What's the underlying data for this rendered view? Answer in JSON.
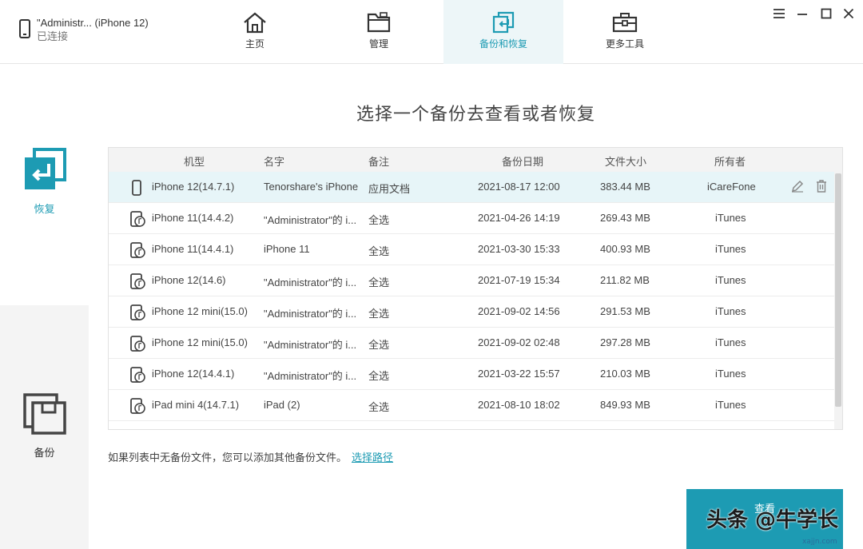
{
  "device": {
    "name": "\"Administr... (iPhone 12)",
    "status": "已连接",
    "icon": "phone-icon"
  },
  "nav": [
    {
      "label": "主页",
      "icon": "home-icon"
    },
    {
      "label": "管理",
      "icon": "folder-icon"
    },
    {
      "label": "备份和恢复",
      "icon": "backup-restore-icon",
      "active": true
    },
    {
      "label": "更多工具",
      "icon": "toolbox-icon"
    }
  ],
  "window_controls": [
    "menu-icon",
    "minimize-icon",
    "maximize-icon",
    "close-icon"
  ],
  "sidebar": {
    "restore_label": "恢复",
    "backup_label": "备份"
  },
  "main": {
    "title": "选择一个备份去查看或者恢复",
    "columns": [
      "机型",
      "名字",
      "备注",
      "备份日期",
      "文件大小",
      "所有者"
    ],
    "rows": [
      {
        "model": "iPhone 12(14.7.1)",
        "name": "Tenorshare's iPhone",
        "note": "应用文档",
        "date": "2021-08-17 12:00",
        "size": "383.44 MB",
        "owner": "iCareFone",
        "selected": true,
        "icon": "phone-icon"
      },
      {
        "model": "iPhone 11(14.4.2)",
        "name": "\"Administrator\"的 i...",
        "note": "全选",
        "date": "2021-04-26 14:19",
        "size": "269.43 MB",
        "owner": "iTunes",
        "icon": "itunes-device-icon"
      },
      {
        "model": "iPhone 11(14.4.1)",
        "name": "iPhone 11",
        "note": "全选",
        "date": "2021-03-30 15:33",
        "size": "400.93 MB",
        "owner": "iTunes",
        "icon": "itunes-device-icon"
      },
      {
        "model": "iPhone 12(14.6)",
        "name": "\"Administrator\"的 i...",
        "note": "全选",
        "date": "2021-07-19 15:34",
        "size": "211.82 MB",
        "owner": "iTunes",
        "icon": "itunes-device-icon"
      },
      {
        "model": "iPhone 12 mini(15.0)",
        "name": "\"Administrator\"的 i...",
        "note": "全选",
        "date": "2021-09-02 14:56",
        "size": "291.53 MB",
        "owner": "iTunes",
        "icon": "itunes-device-icon"
      },
      {
        "model": "iPhone 12 mini(15.0)",
        "name": "\"Administrator\"的 i...",
        "note": "全选",
        "date": "2021-09-02 02:48",
        "size": "297.28 MB",
        "owner": "iTunes",
        "icon": "itunes-device-icon"
      },
      {
        "model": "iPhone 12(14.4.1)",
        "name": "\"Administrator\"的 i...",
        "note": "全选",
        "date": "2021-03-22 15:57",
        "size": "210.03 MB",
        "owner": "iTunes",
        "icon": "itunes-device-icon"
      },
      {
        "model": "iPad mini 4(14.7.1)",
        "name": "iPad (2)",
        "note": "全选",
        "date": "2021-08-10 18:02",
        "size": "849.93 MB",
        "owner": "iTunes",
        "icon": "itunes-device-icon"
      }
    ],
    "hint": "如果列表中无备份文件，您可以添加其他备份文件。",
    "hint_link": "选择路径",
    "view_button": "查看"
  },
  "watermark": {
    "text": "头条 @牛学长",
    "site": "xajjn.com"
  },
  "colors": {
    "accent": "#1d9bb3",
    "selected_row": "#e7f5f8",
    "header_bg": "#f3f3f3"
  }
}
